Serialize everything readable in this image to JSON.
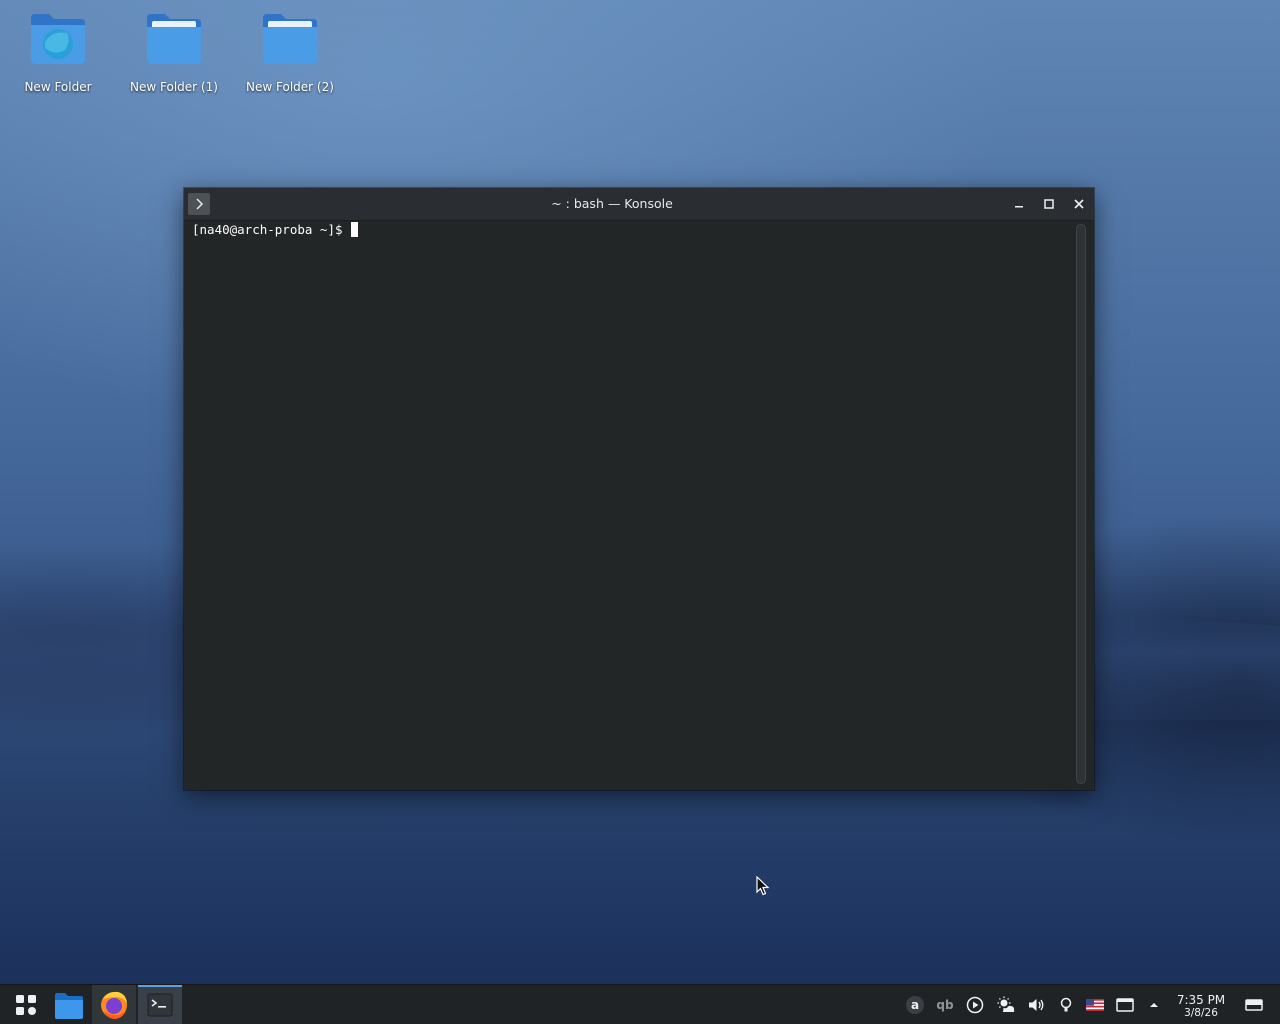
{
  "desktop": {
    "icons": [
      {
        "label": "New Folder",
        "icon": "folder-globe-icon"
      },
      {
        "label": "New Folder (1)",
        "icon": "folder-icon"
      },
      {
        "label": "New Folder (2)",
        "icon": "folder-icon"
      }
    ]
  },
  "window": {
    "title": "~ : bash — Konsole",
    "menu_icon": "chevron-right-icon",
    "buttons": [
      "minimize-icon",
      "maximize-icon",
      "close-icon"
    ]
  },
  "terminal": {
    "prompt": "[na40@arch-proba ~]$ "
  },
  "taskbar": {
    "apps": [
      "app-launcher-icon",
      "file-manager-icon",
      "firefox-icon",
      "konsole-icon"
    ],
    "tray": [
      "a-badge-icon",
      "qbittorrent-icon",
      "media-player-icon",
      "weather-icon",
      "volume-icon",
      "bulb-icon",
      "us-flag-icon",
      "display-icon",
      "expand-tray-icon"
    ],
    "clock_time": "7:35 PM",
    "clock_date": "3/8/26",
    "show_desktop_icon": "show-desktop-icon"
  },
  "colors": {
    "terminal_bg": "#232627",
    "titlebar_bg": "#2a2e32",
    "taskbar_bg": "#202326",
    "folder_blue": "#3f8ee0",
    "accent": "#5fa0e3"
  }
}
